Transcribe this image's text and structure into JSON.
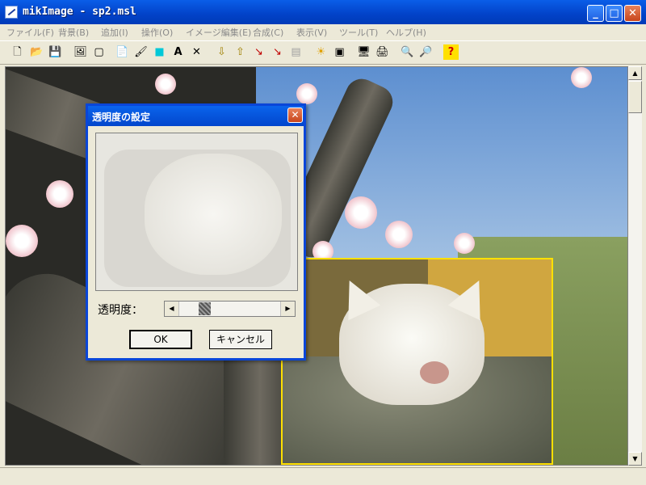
{
  "window": {
    "title": "mikImage - sp2.msl"
  },
  "caption_buttons": {
    "minimize": "_",
    "maximize": "□",
    "close": "✕"
  },
  "menu": [
    {
      "label": "ファイル(F)"
    },
    {
      "label": "背景(B)"
    },
    {
      "label": "追加(I)"
    },
    {
      "label": "操作(O)"
    },
    {
      "label": "イメージ編集(E)"
    },
    {
      "label": "合成(C)"
    },
    {
      "label": "表示(V)"
    },
    {
      "label": "ツール(T)"
    },
    {
      "label": "ヘルプ(H)"
    }
  ],
  "toolbar": [
    {
      "icon": "new-file-icon",
      "glyph": "🗋"
    },
    {
      "icon": "open-folder-icon",
      "glyph": "📂"
    },
    {
      "icon": "save-icon",
      "glyph": "💾"
    },
    {
      "icon": "image-icon",
      "glyph": "🖼"
    },
    {
      "icon": "frame-icon",
      "glyph": "▢"
    },
    {
      "icon": "copy-icon",
      "glyph": "📄"
    },
    {
      "icon": "paint-icon",
      "glyph": "🖌"
    },
    {
      "icon": "fill-color-icon",
      "glyph": "■"
    },
    {
      "icon": "text-icon",
      "glyph": "A"
    },
    {
      "icon": "delete-icon",
      "glyph": "✕"
    },
    {
      "icon": "layer-down-icon",
      "glyph": "⇩"
    },
    {
      "icon": "layer-up-icon",
      "glyph": "⇧"
    },
    {
      "icon": "curve-icon",
      "glyph": "↘"
    },
    {
      "icon": "curve-alt-icon",
      "glyph": "↘"
    },
    {
      "icon": "disabled-icon",
      "glyph": "▤"
    },
    {
      "icon": "brightness-icon",
      "glyph": "☀"
    },
    {
      "icon": "select-icon",
      "glyph": "▣"
    },
    {
      "icon": "monitor-icon",
      "glyph": "🖥"
    },
    {
      "icon": "print-icon",
      "glyph": "🖨"
    },
    {
      "icon": "zoom-in-icon",
      "glyph": "🔍"
    },
    {
      "icon": "zoom-out-icon",
      "glyph": "🔎"
    },
    {
      "icon": "help-icon",
      "glyph": "?"
    }
  ],
  "scrollbar": {
    "up": "▲",
    "down": "▼"
  },
  "dialog": {
    "title": "透明度の設定",
    "close": "✕",
    "slider_label": "透明度：",
    "slider_left": "◀",
    "slider_right": "▶",
    "opacity_fraction": 0.22,
    "ok_label": "OK",
    "cancel_label": "キャンセル"
  },
  "colors": {
    "title_blue": "#0246cc",
    "selection_yellow": "#ffe000"
  }
}
